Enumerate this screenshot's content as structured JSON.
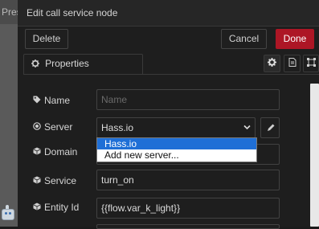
{
  "background_strip": {
    "truncated_label": "Pres"
  },
  "tray": {
    "title": "Edit call service node",
    "buttons": {
      "delete": "Delete",
      "cancel": "Cancel",
      "done": "Done"
    },
    "tabs": {
      "properties": "Properties"
    },
    "colors": {
      "done_bg": "#ad1625",
      "selected_option": "#1f6fd6"
    }
  },
  "form": {
    "name": {
      "label": "Name",
      "value": "",
      "placeholder": "Name"
    },
    "server": {
      "label": "Server",
      "value": "Hass.io",
      "options": [
        "Hass.io",
        "Add new server..."
      ],
      "selected_index": 0
    },
    "domain": {
      "label": "Domain",
      "value": ""
    },
    "service": {
      "label": "Service",
      "value": "turn_on"
    },
    "entity_id": {
      "label": "Entity Id",
      "value": "{{flow.var_k_light}}"
    }
  },
  "icons": [
    "tag-icon",
    "dot-circle-icon",
    "cube-icon",
    "pencil-icon",
    "gear-icon",
    "document-icon",
    "frame-icon",
    "chevron-down-icon"
  ]
}
